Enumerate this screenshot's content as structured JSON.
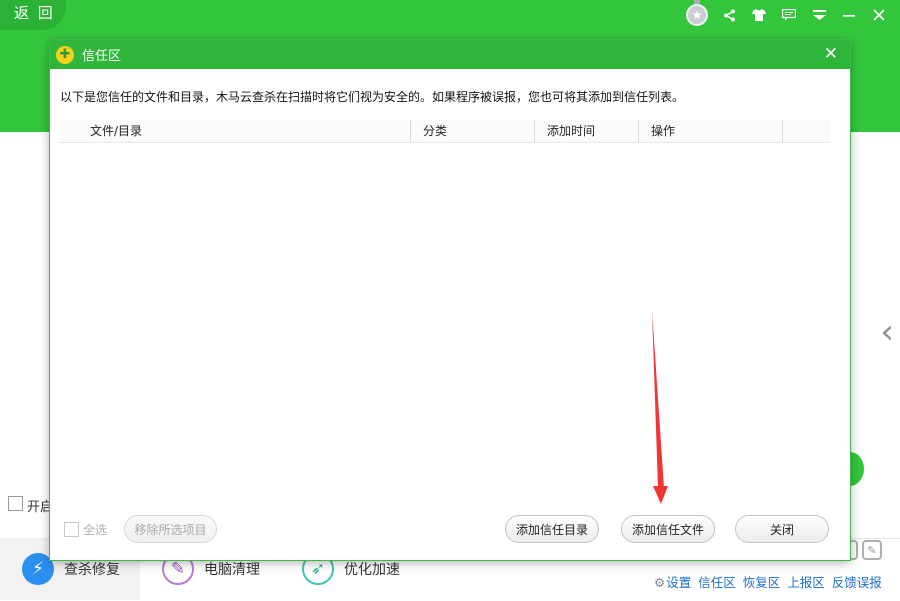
{
  "app": {
    "back_label": "返 回",
    "right_arrow": "‹",
    "bg_checkbox_label": "开启",
    "top_icons": [
      "share-icon",
      "skin-icon",
      "message-icon",
      "menu-icon",
      "minimize-icon",
      "close-icon"
    ],
    "colors": {
      "brand_green": "#33c63d",
      "link_blue": "#1e6fd1",
      "annotation_red": "#f03535"
    }
  },
  "nav": {
    "items": [
      {
        "label": "查杀修复",
        "icon": "lightning-icon",
        "active": true
      },
      {
        "label": "电脑清理",
        "icon": "broom-icon",
        "active": false
      },
      {
        "label": "优化加速",
        "icon": "rocket-icon",
        "active": false
      }
    ]
  },
  "bottom_links": {
    "settings": "设置",
    "trust_zone": "信任区",
    "restore_zone": "恢复区",
    "report_zone": "上报区",
    "feedback": "反馈误报"
  },
  "dialog": {
    "title": "信任区",
    "close": "✕",
    "description": "以下是您信任的文件和目录，木马云查杀在扫描时将它们视为安全的。如果程序被误报，您也可将其添加到信任列表。",
    "columns": [
      "文件/目录",
      "分类",
      "添加时间",
      "操作"
    ],
    "rows": [],
    "select_all_label": "全选",
    "remove_selected_label": "移除所选项目",
    "add_trust_dir_label": "添加信任目录",
    "add_trust_file_label": "添加信任文件",
    "close_label": "关闭"
  }
}
